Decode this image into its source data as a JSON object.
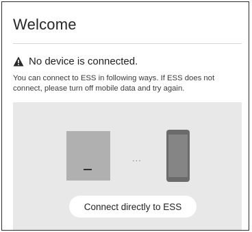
{
  "header": {
    "title": "Welcome"
  },
  "status": {
    "icon": "warning-icon",
    "message": "No device is connected."
  },
  "description": "You can connect to ESS in following ways. If ESS does not connect, please turn off mobile data and try again.",
  "illustration": {
    "left_device": "ess-device-icon",
    "separator": "...",
    "right_device": "phone-icon"
  },
  "actions": {
    "connect_label": "Connect directly to ESS"
  },
  "colors": {
    "panel_bg": "#e8e8e8",
    "ess_device": "#b0b0b0",
    "phone": "#6b6b6b"
  }
}
